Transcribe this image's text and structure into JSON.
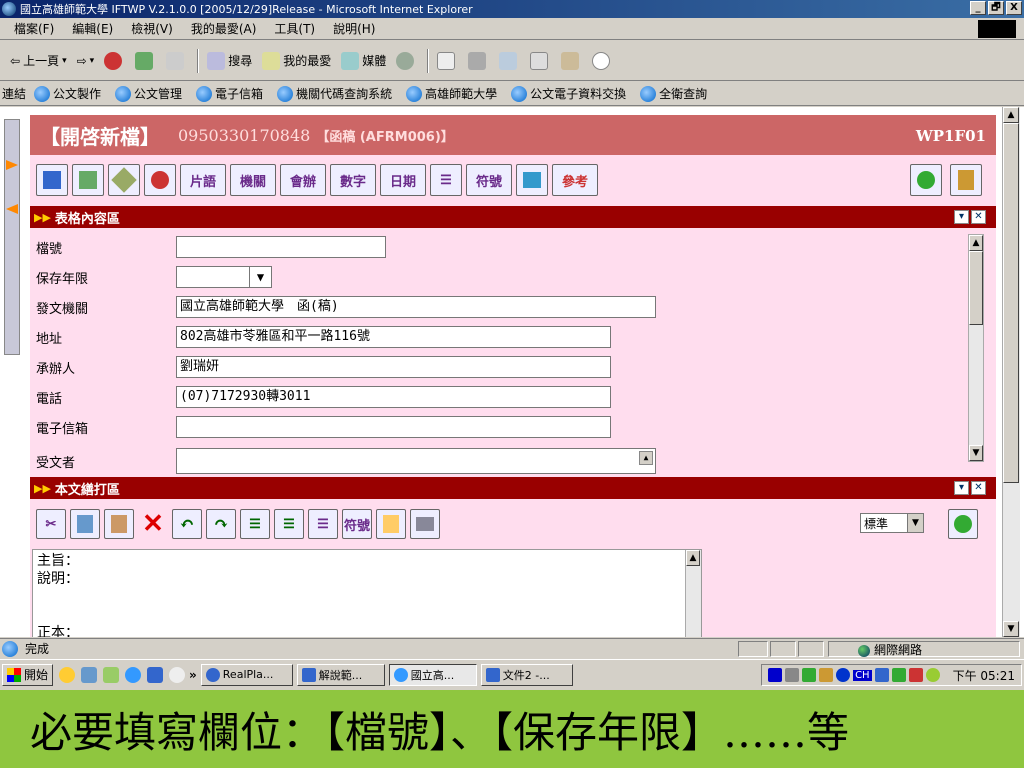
{
  "window": {
    "title": "國立高雄師範大學   IFTWP V.2.1.0.0 [2005/12/29]Release - Microsoft Internet Explorer",
    "min": "_",
    "max": "🗗",
    "close": "X"
  },
  "menu": [
    "檔案(F)",
    "編輯(E)",
    "檢視(V)",
    "我的最愛(A)",
    "工具(T)",
    "說明(H)"
  ],
  "toolbar": {
    "back": "上一頁",
    "search": "搜尋",
    "favorites": "我的最愛",
    "media": "媒體"
  },
  "links": {
    "label": "連結",
    "items": [
      "公文製作",
      "公文管理",
      "電子信箱",
      "機關代碼查詢系統",
      "高雄師範大學",
      "公文電子資料交換",
      "全衛查詢"
    ]
  },
  "page": {
    "title": "【開啓新檔】",
    "doc_number": "0950330170848",
    "draft_label": "【函稿 (AFRM006)】",
    "form_code": "WP1F01",
    "icon_labels": [
      "片語",
      "機關",
      "會辦",
      "數字",
      "日期",
      "符號",
      "參考"
    ]
  },
  "form_section": {
    "title": "表格內容區",
    "fields": [
      {
        "label": "檔號",
        "value": ""
      },
      {
        "label": "保存年限",
        "value": ""
      },
      {
        "label": "發文機關",
        "value": "國立高雄師範大學　函(稿)"
      },
      {
        "label": "地址",
        "value": "802高雄市苓雅區和平一路116號"
      },
      {
        "label": "承辦人",
        "value": "劉瑞妍"
      },
      {
        "label": "電話",
        "value": "(07)7172930轉3011"
      },
      {
        "label": "電子信箱",
        "value": ""
      },
      {
        "label": "受文者",
        "value": ""
      }
    ]
  },
  "editor_section": {
    "title": "本文繕打區",
    "icon_label": "符號",
    "style_select": "標準",
    "content_lines": [
      "主旨：",
      "說明：",
      "",
      "",
      "正本："
    ]
  },
  "status": {
    "text": "完成",
    "zone": "網際網路"
  },
  "taskbar": {
    "start": "開始",
    "tasks": [
      "RealPla...",
      "解說範...",
      "國立高...",
      "文件2 -..."
    ],
    "lang": "CH",
    "clock": "下午 05:21"
  },
  "caption": "必要填寫欄位：【檔號】、【保存年限】……等"
}
